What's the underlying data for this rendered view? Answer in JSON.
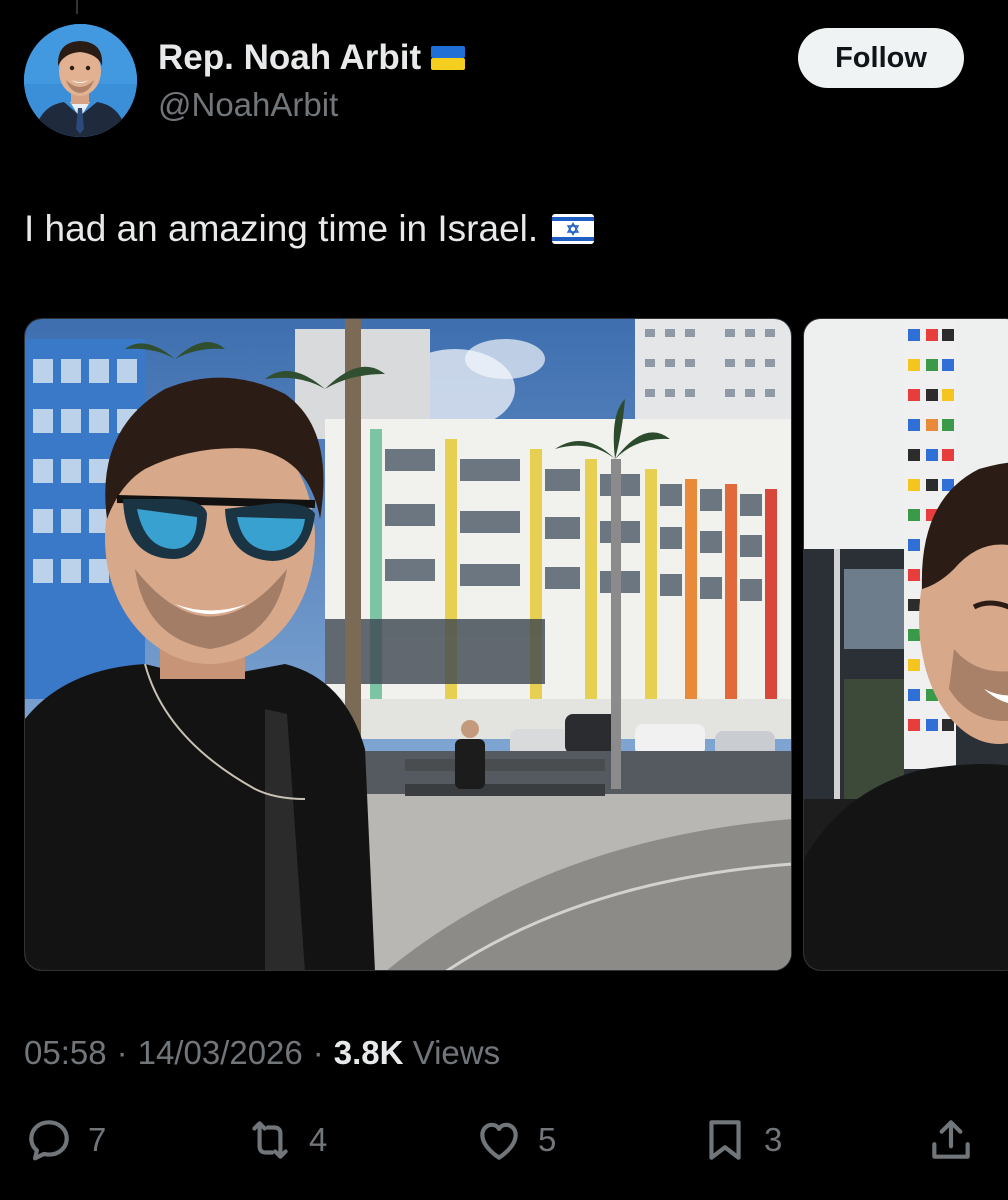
{
  "author": {
    "display_name": "Rep. Noah Arbit",
    "handle": "@NoahArbit",
    "badge_icon": "ukraine-flag-icon"
  },
  "follow_label": "Follow",
  "tweet": {
    "text": "I had an amazing time in Israel.",
    "emoji_icon": "israel-flag-icon"
  },
  "media": [
    {
      "name": "selfie-photo-tel-aviv-promenade"
    },
    {
      "name": "selfie-photo-colorful-pillar"
    }
  ],
  "meta": {
    "time": "05:58",
    "separator": "·",
    "date": "14/03/2026",
    "views_count": "3.8K",
    "views_label": "Views"
  },
  "actions": {
    "replies": "7",
    "reposts": "4",
    "likes": "5",
    "bookmarks": "3"
  },
  "colors": {
    "background": "#000000",
    "primary_text": "#e7e9ea",
    "secondary_text": "#71767b",
    "follow_button_bg": "#eff3f4"
  }
}
